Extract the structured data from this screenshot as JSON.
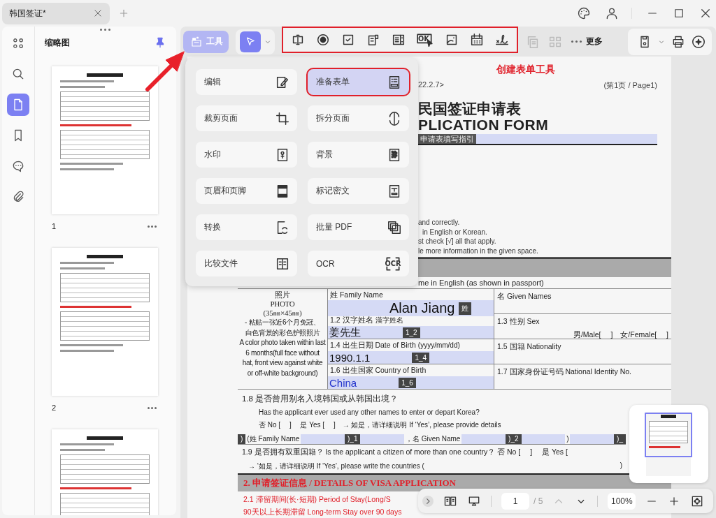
{
  "tabs": [
    {
      "label": "韩国签证*",
      "selected": true
    }
  ],
  "rail": [
    {
      "kind": "grid",
      "selected": false
    },
    {
      "kind": "search",
      "selected": false
    },
    {
      "kind": "page",
      "selected": true
    },
    {
      "kind": "bookmark",
      "selected": false
    },
    {
      "kind": "comment",
      "selected": false
    },
    {
      "kind": "clip",
      "selected": false
    }
  ],
  "thumbnails": {
    "title": "缩略图",
    "pages": [
      {
        "number": "1"
      },
      {
        "number": "2"
      }
    ]
  },
  "toolbar": {
    "tools_button": {
      "label": "工具",
      "selected": true
    },
    "form_tools": [
      {
        "kind": "textfield"
      },
      {
        "kind": "radio"
      },
      {
        "kind": "checkbox"
      },
      {
        "kind": "combobox"
      },
      {
        "kind": "listbox"
      },
      {
        "kind": "button",
        "text": "OK"
      },
      {
        "kind": "image"
      },
      {
        "kind": "date"
      },
      {
        "kind": "signature"
      }
    ],
    "extra_tools": [
      {
        "kind": "copy",
        "disabled": true
      },
      {
        "kind": "grid2",
        "disabled": true
      }
    ],
    "more": "更多"
  },
  "tools_menu": [
    {
      "label": "编辑",
      "kind": "edit",
      "selected": false
    },
    {
      "label": "准备表单",
      "kind": "form",
      "selected": true
    },
    {
      "label": "裁剪页面",
      "kind": "crop",
      "selected": false
    },
    {
      "label": "拆分页面",
      "kind": "split",
      "selected": false
    },
    {
      "label": "水印",
      "kind": "watermark",
      "selected": false
    },
    {
      "label": "背景",
      "kind": "background",
      "selected": false
    },
    {
      "label": "页眉和页脚",
      "kind": "headerfooter",
      "selected": false
    },
    {
      "label": "标记密文",
      "kind": "redact",
      "selected": false
    },
    {
      "label": "转换",
      "kind": "convert",
      "selected": false
    },
    {
      "label": "批量 PDF",
      "kind": "batch",
      "selected": false
    },
    {
      "label": "比较文件",
      "kind": "compare",
      "selected": false
    },
    {
      "label": "OCR",
      "kind": "ocr",
      "selected": false,
      "icon_text": "OCR"
    }
  ],
  "document": {
    "annotation": "创建表单工具",
    "date_fragment": "22.2.7>",
    "page_label": "(第1页 / Page1)",
    "title_cn": "民国签证申请表",
    "title_en": "PLICATION FORM",
    "guide_label": "申请表填写指引",
    "instructions": [
      "and correctly.",
      "in English or Korean.",
      "st check [√] all that apply.",
      "le more information in the given space."
    ],
    "name_caption": "me in English (as shown in passport)",
    "photo_lines": [
      "照片",
      "PHOTO",
      "(35㎜×45㎜)",
      "- 粘贴一张近6个月免冠、",
      "白色背景的彩色护照照片",
      "A color photo taken within last",
      "6 months(full face without",
      "hat, front view against white",
      "or off-white background)"
    ],
    "rows": [
      {
        "label": "姓 Family Name",
        "value": "Alan Jiang",
        "tag": "姓",
        "color": "#111111",
        "right": "名 Given Names"
      },
      {
        "label": "1.2 汉字姓名",
        "sublabel": "漢字姓名",
        "value": "姜先生",
        "tag": "1_2",
        "color": "#111111",
        "right": "1.3 性别 Sex",
        "right_extra": "男/Male[　 ]　女/Female[　 ]"
      },
      {
        "label": "1.4 出生日期 Date of Birth",
        "sublabel": "(yyyy/mm/dd)",
        "value": "1990.1.1",
        "tag": "1_4",
        "color": "#111111",
        "right": "1.5 国籍  Nationality"
      },
      {
        "label": "1.6 出生国家 Country of Birth",
        "value": "China",
        "tag": "1_6",
        "color": "#2233cc",
        "right": "1.7 国家身份证号码 National Identity No."
      }
    ],
    "q18_title": "1.8  是否曾用别名入境韩国或从韩国出境？",
    "q18_en": "Has the applicant ever used any other names to enter or depart Korea?",
    "q18_options": "否 No [　 ]　 是 Yes [　 ]　→ 如是，请详细说明 If ‘Yes’, please provide details",
    "alias_row": [
      {
        "kind": "tag",
        "text": ")"
      },
      {
        "kind": "text",
        "text": "(姓 Family Name"
      },
      {
        "kind": "field"
      },
      {
        "kind": "tag",
        "text": ")_1"
      },
      {
        "kind": "field"
      },
      {
        "kind": "text",
        "text": "，名 Given Name"
      },
      {
        "kind": "field"
      },
      {
        "kind": "tag",
        "text": ")_2"
      },
      {
        "kind": "field"
      },
      {
        "kind": "text",
        "text": ")"
      },
      {
        "kind": "field"
      },
      {
        "kind": "tag",
        "text": ")_"
      }
    ],
    "q19": "1.9 是否拥有双重国籍？ Is the applicant a citizen of more than one country？  否 No [　 ]　 是 Yes [",
    "q19_note": "→ ‘如是，请详细说明 If ‘Yes’, please write the countries  (",
    "q19_close": ")",
    "section2": "2. 申请签证信息 / DETAILS OF VISA APPLICATION",
    "q21": "2.1 滞留期间(长·短期) Period of Stay(Long/S",
    "q21_long": "90天以上长期滞留 Long-term Stay over 90 days"
  },
  "page_nav": {
    "page": "1",
    "total": "/ 5",
    "zoom": "100%"
  }
}
